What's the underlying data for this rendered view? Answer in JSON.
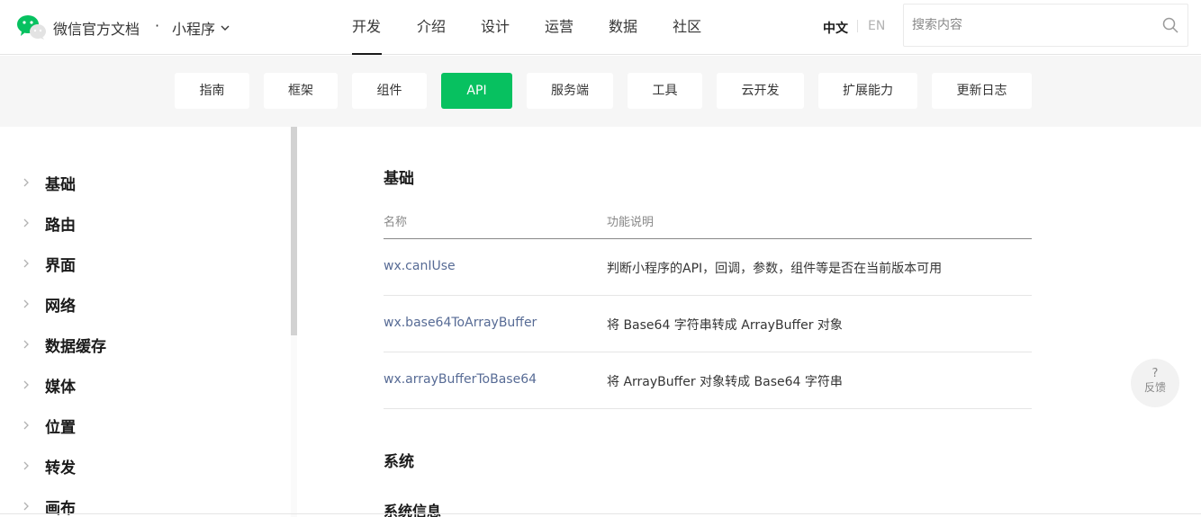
{
  "header": {
    "brand": "微信官方文档",
    "dot": "·",
    "product": "小程序",
    "nav": [
      "开发",
      "介绍",
      "设计",
      "运营",
      "数据",
      "社区"
    ],
    "active_nav_index": 0,
    "lang_zh": "中文",
    "lang_en": "EN",
    "search_placeholder": "搜索内容"
  },
  "subnav": {
    "items": [
      "指南",
      "框架",
      "组件",
      "API",
      "服务端",
      "工具",
      "云开发",
      "扩展能力",
      "更新日志"
    ],
    "active": "API"
  },
  "sidebar": {
    "items": [
      "基础",
      "路由",
      "界面",
      "网络",
      "数据缓存",
      "媒体",
      "位置",
      "转发",
      "画布"
    ]
  },
  "content": {
    "section1_title": "基础",
    "col_name": "名称",
    "col_desc": "功能说明",
    "rows": [
      {
        "api": "wx.canIUse",
        "desc": "判断小程序的API，回调，参数，组件等是否在当前版本可用"
      },
      {
        "api": "wx.base64ToArrayBuffer",
        "desc": "将 Base64 字符串转成 ArrayBuffer 对象"
      },
      {
        "api": "wx.arrayBufferToBase64",
        "desc": "将 ArrayBuffer 对象转成 Base64 字符串"
      }
    ],
    "section2_title": "系统",
    "subsection_title": "系统信息"
  },
  "feedback": {
    "icon": "?",
    "label": "反馈"
  },
  "colors": {
    "accent": "#07c160",
    "link": "#576b95"
  }
}
